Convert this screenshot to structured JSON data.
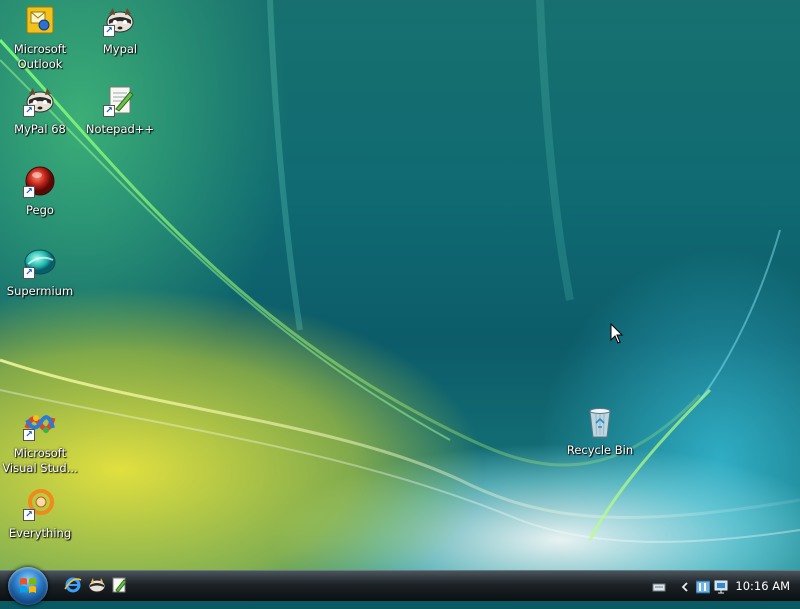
{
  "desktop": {
    "icons": [
      {
        "label": "Microsoft\nOutlook",
        "line1": "Microsoft",
        "line2": "Outlook",
        "icon": "outlook-icon",
        "shortcut": false
      },
      {
        "label": "Mypal",
        "line1": "Mypal",
        "line2": "",
        "icon": "raccoon-icon",
        "shortcut": true
      },
      {
        "label": "MyPal 68",
        "line1": "MyPal 68",
        "line2": "",
        "icon": "raccoon-icon",
        "shortcut": true
      },
      {
        "label": "Notepad++",
        "line1": "Notepad++",
        "line2": "",
        "icon": "notepad-icon",
        "shortcut": true
      },
      {
        "label": "Pego",
        "line1": "Pego",
        "line2": "",
        "icon": "red-orb-icon",
        "shortcut": true
      },
      {
        "label": "Supermium",
        "line1": "Supermium",
        "line2": "",
        "icon": "supermium-icon",
        "shortcut": true
      },
      {
        "label": "Microsoft Visual Stud...",
        "line1": "Microsoft",
        "line2": "Visual Stud...",
        "icon": "visual-studio-icon",
        "shortcut": true
      },
      {
        "label": "Everything",
        "line1": "Everything",
        "line2": "",
        "icon": "everything-icon",
        "shortcut": true
      },
      {
        "label": "Recycle Bin",
        "line1": "Recycle Bin",
        "line2": "",
        "icon": "recycle-bin-icon",
        "shortcut": false
      }
    ]
  },
  "taskbar": {
    "start_button": "start-orb",
    "quick_launch": [
      "internet-explorer-icon",
      "raccoon-icon",
      "notepad-icon"
    ],
    "tray_icons": [
      "keyboard-icon",
      "show-hidden-icons-chevron",
      "language-bar-icon",
      "network-monitor-icon"
    ],
    "clock": "10:16 AM"
  }
}
